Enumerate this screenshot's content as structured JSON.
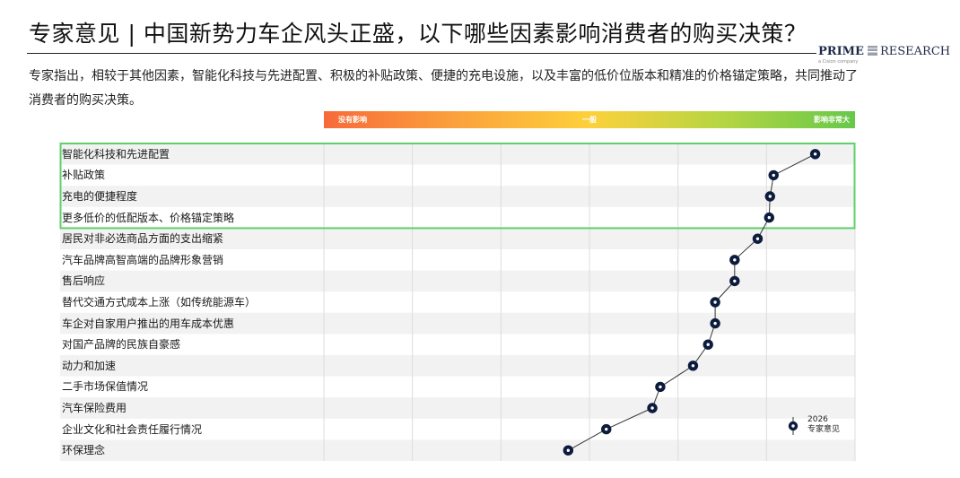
{
  "title": "专家意见 | 中国新势力车企风头正盛，以下哪些因素影响消费者的购买决策？",
  "logo": {
    "brand_bold": "PRIME",
    "brand_rest": "RESEARCH",
    "sub": "a Cision company"
  },
  "subtitle": "专家指出，相较于其他因素，智能化科技与先进配置、积极的补贴政策、便捷的充电设施，以及丰富的低价位版本和精准的价格锚定策略，共同推动了消费者的购买决策。",
  "scale": {
    "low": "没有影响",
    "mid": "一般",
    "high": "影响非常大"
  },
  "colors": {
    "marker": "#0d1b3d",
    "highlight_border": "#5fd06a",
    "row_band": "#f2f2f2",
    "gridline": "#dcdcdc",
    "connector": "#333333"
  },
  "legend": {
    "series_label": "2026\n专家意见"
  },
  "chart_data": {
    "type": "scatter",
    "orientation": "horizontal",
    "title": "",
    "xlabel": "",
    "ylabel": "",
    "xlim": [
      0,
      6
    ],
    "categories": [
      "智能化科技和先进配置",
      "补贴政策",
      "充电的便捷程度",
      "更多低价的低配版本、价格锚定策略",
      "居民对非必选商品方面的支出缩紧",
      "汽车品牌高智高端的品牌形象营销",
      "售后响应",
      "替代交通方式成本上涨（如传统能源车）",
      "车企对自家用户推出的用车成本优惠",
      "对国产品牌的民族自豪感",
      "动力和加速",
      "二手市场保值情况",
      "汽车保险费用",
      "企业文化和社会责任履行情况",
      "环保理念"
    ],
    "series": [
      {
        "name": "2026 专家意见",
        "values": [
          5.55,
          5.08,
          5.04,
          5.03,
          4.9,
          4.64,
          4.64,
          4.42,
          4.42,
          4.34,
          4.17,
          3.8,
          3.71,
          3.19,
          2.76
        ]
      }
    ],
    "highlighted_categories": [
      0,
      1,
      2,
      3
    ],
    "grid": true,
    "legend_position": "bottom-right"
  }
}
